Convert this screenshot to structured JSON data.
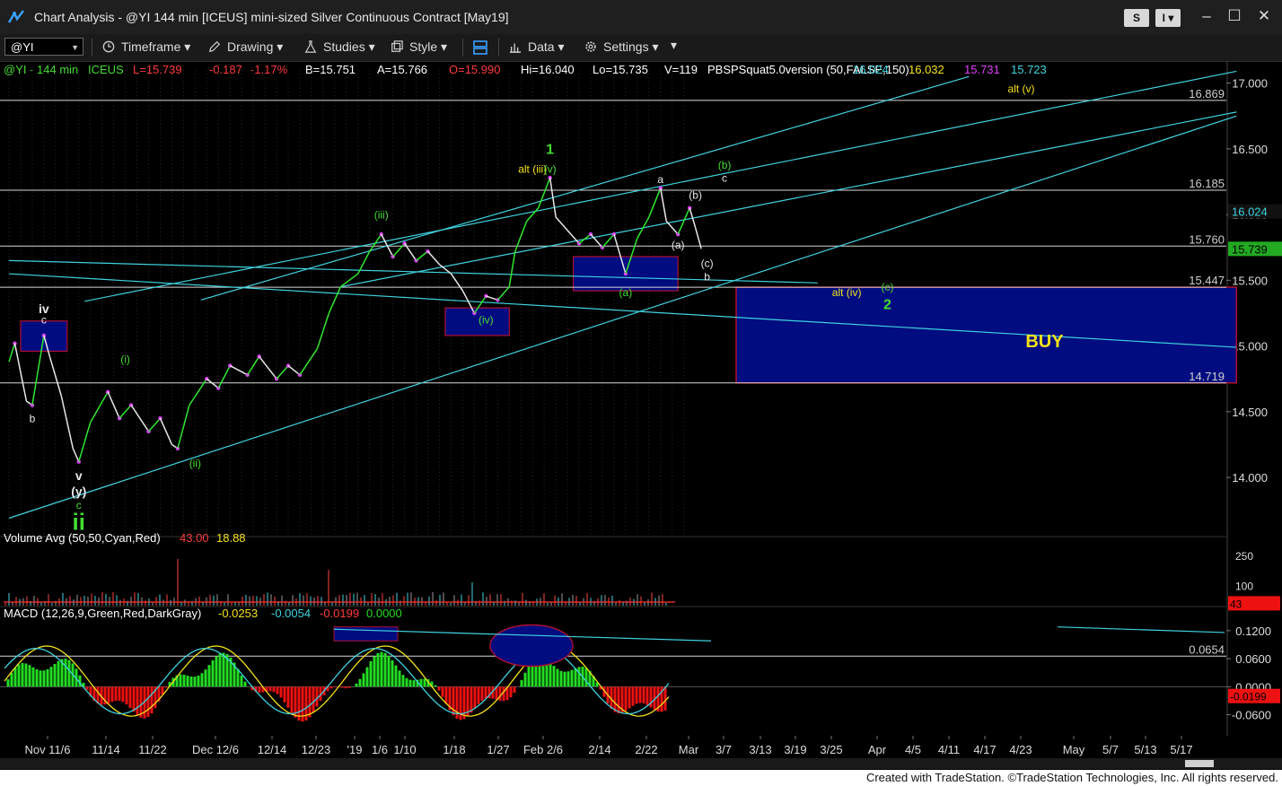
{
  "window": {
    "title": "Chart Analysis - @YI 144 min [ICEUS] mini-sized Silver Continuous Contract [May19]",
    "buttons": [
      "S",
      "I"
    ]
  },
  "toolbar": {
    "symbol": "@YI",
    "items": [
      "Timeframe",
      "Drawing",
      "Studies",
      "Style",
      "Data",
      "Settings"
    ]
  },
  "legend": {
    "symbol": "@YI - 144 min",
    "exchange": "ICEUS",
    "last": "L=15.739",
    "change": "-0.187",
    "pct": "-1.17%",
    "bid": "B=15.751",
    "ask": "A=15.766",
    "open": "O=15.990",
    "hi": "Hi=16.040",
    "lo": "Lo=15.735",
    "vol": "V=119",
    "indicator": "PBSPSquat5.0version (50,FALSE,150)",
    "ind_values": [
      "16.024",
      "16.032",
      "15.731",
      "15.723"
    ]
  },
  "colors": {
    "background": "#000000",
    "grid": "#3a3a3a",
    "cyan": "#3fd3e0",
    "up_bar": "#2ee82e",
    "down_bar": "#e8e8e8",
    "macd_pos": "#22dd22",
    "macd_neg": "#ee1111",
    "buy_box": "#000c80",
    "yellow": "#f5e21a",
    "green": "#44dd33",
    "magenta": "#e040fb"
  },
  "chart_data": [
    {
      "type": "line",
      "title": "@YI - 144 min",
      "y_axis_ticks": [
        "17.000",
        "16.500",
        "16.000",
        "15.500",
        "15.000",
        "14.500",
        "14.000"
      ],
      "ylim": [
        13.55,
        17.1
      ],
      "x_axis_labels": [
        "Nov 11/6",
        "11/14",
        "11/22",
        "Dec 12/6",
        "12/14",
        "12/23",
        "'19",
        "1/6",
        "1/10",
        "1/18",
        "1/27",
        "Feb 2/6",
        "2/14",
        "2/22",
        "Mar",
        "3/7",
        "3/13",
        "3/19",
        "3/25",
        "Apr",
        "4/5",
        "4/11",
        "4/17",
        "4/23",
        "May",
        "5/7",
        "5/13",
        "5/17"
      ],
      "price_path": [
        {
          "x": "Nov 1",
          "y": 14.88
        },
        {
          "x": "Nov 2",
          "y": 15.02
        },
        {
          "x": "Nov 4",
          "y": 14.58
        },
        {
          "x": "Nov 5",
          "y": 14.55
        },
        {
          "x": "Nov 7",
          "y": 15.08
        },
        {
          "x": "Nov 8",
          "y": 14.92
        },
        {
          "x": "Nov 10",
          "y": 14.62
        },
        {
          "x": "Nov 12",
          "y": 14.22
        },
        {
          "x": "Nov 13",
          "y": 14.12
        },
        {
          "x": "Nov 15",
          "y": 14.42
        },
        {
          "x": "Nov 18",
          "y": 14.65
        },
        {
          "x": "Nov 20",
          "y": 14.45
        },
        {
          "x": "Nov 22",
          "y": 14.55
        },
        {
          "x": "Nov 25",
          "y": 14.35
        },
        {
          "x": "Nov 27",
          "y": 14.45
        },
        {
          "x": "Nov 29",
          "y": 14.25
        },
        {
          "x": "Nov 30",
          "y": 14.22
        },
        {
          "x": "Dec 2",
          "y": 14.55
        },
        {
          "x": "Dec 5",
          "y": 14.75
        },
        {
          "x": "Dec 7",
          "y": 14.68
        },
        {
          "x": "Dec 9",
          "y": 14.85
        },
        {
          "x": "Dec 12",
          "y": 14.78
        },
        {
          "x": "Dec 14",
          "y": 14.92
        },
        {
          "x": "Dec 17",
          "y": 14.75
        },
        {
          "x": "Dec 19",
          "y": 14.85
        },
        {
          "x": "Dec 21",
          "y": 14.78
        },
        {
          "x": "Dec 24",
          "y": 14.98
        },
        {
          "x": "Dec 26",
          "y": 15.25
        },
        {
          "x": "Dec 28",
          "y": 15.45
        },
        {
          "x": "Dec 31",
          "y": 15.55
        },
        {
          "x": "Jan 2",
          "y": 15.72
        },
        {
          "x": "Jan 4",
          "y": 15.85
        },
        {
          "x": "Jan 6",
          "y": 15.68
        },
        {
          "x": "Jan 8",
          "y": 15.78
        },
        {
          "x": "Jan 10",
          "y": 15.65
        },
        {
          "x": "Jan 12",
          "y": 15.72
        },
        {
          "x": "Jan 14",
          "y": 15.62
        },
        {
          "x": "Jan 16",
          "y": 15.55
        },
        {
          "x": "Jan 18",
          "y": 15.42
        },
        {
          "x": "Jan 20",
          "y": 15.25
        },
        {
          "x": "Jan 22",
          "y": 15.38
        },
        {
          "x": "Jan 24",
          "y": 15.35
        },
        {
          "x": "Jan 26",
          "y": 15.45
        },
        {
          "x": "Jan 27",
          "y": 15.72
        },
        {
          "x": "Jan 29",
          "y": 15.95
        },
        {
          "x": "Jan 31",
          "y": 16.05
        },
        {
          "x": "Feb 2",
          "y": 16.28
        },
        {
          "x": "Feb 3",
          "y": 15.98
        },
        {
          "x": "Feb 5",
          "y": 15.88
        },
        {
          "x": "Feb 7",
          "y": 15.78
        },
        {
          "x": "Feb 9",
          "y": 15.85
        },
        {
          "x": "Feb 11",
          "y": 15.75
        },
        {
          "x": "Feb 13",
          "y": 15.85
        },
        {
          "x": "Feb 15",
          "y": 15.55
        },
        {
          "x": "Feb 17",
          "y": 15.82
        },
        {
          "x": "Feb 19",
          "y": 15.98
        },
        {
          "x": "Feb 21",
          "y": 16.2
        },
        {
          "x": "Feb 22",
          "y": 15.95
        },
        {
          "x": "Feb 24",
          "y": 15.85
        },
        {
          "x": "Feb 26",
          "y": 16.05
        },
        {
          "x": "Feb 27",
          "y": 15.9
        },
        {
          "x": "Feb 28",
          "y": 15.74
        }
      ],
      "horizontal_levels": [
        "16.869",
        "16.185",
        "15.760",
        "15.447",
        "14.719"
      ],
      "last_price": "15.739",
      "indicator_value": "16.024",
      "wave_labels": [
        {
          "text": "iv",
          "x": "Nov 7",
          "y": 15.25,
          "color": "white"
        },
        {
          "text": "c",
          "x": "Nov 7",
          "y": 15.17,
          "color": "white"
        },
        {
          "text": "b",
          "x": "Nov 5",
          "y": 14.42,
          "color": "white"
        },
        {
          "text": "(i)",
          "x": "Nov 21",
          "y": 14.87,
          "color": "green"
        },
        {
          "text": "(ii)",
          "x": "Dec 3",
          "y": 14.08,
          "color": "green"
        },
        {
          "text": "v",
          "x": "Nov 13",
          "y": 13.98,
          "color": "white"
        },
        {
          "text": "(y)",
          "x": "Nov 13",
          "y": 13.86,
          "color": "white"
        },
        {
          "text": "c",
          "x": "Nov 13",
          "y": 13.76,
          "color": "green"
        },
        {
          "text": "ii",
          "x": "Nov 13",
          "y": 13.6,
          "color": "green"
        },
        {
          "text": "(iii)",
          "x": "Jan 4",
          "y": 15.97,
          "color": "green"
        },
        {
          "text": "(iv)",
          "x": "Jan 22",
          "y": 15.17,
          "color": "green"
        },
        {
          "text": "alt (iii)",
          "x": "Jan 30",
          "y": 16.32,
          "color": "yellow"
        },
        {
          "text": "1",
          "x": "Feb 2",
          "y": 16.46,
          "color": "green"
        },
        {
          "text": "(v)",
          "x": "Feb 2",
          "y": 16.32,
          "color": "green"
        },
        {
          "text": "a",
          "x": "Feb 21",
          "y": 16.24,
          "color": "white"
        },
        {
          "text": "(b)",
          "x": "Feb 27",
          "y": 16.12,
          "color": "white"
        },
        {
          "text": "(a)",
          "x": "Feb 24",
          "y": 15.74,
          "color": "white"
        },
        {
          "text": "(a)",
          "x": "Feb 15",
          "y": 15.38,
          "color": "green"
        },
        {
          "text": "(c)",
          "x": "Mar 1",
          "y": 15.6,
          "color": "white"
        },
        {
          "text": "b",
          "x": "Mar 1",
          "y": 15.5,
          "color": "white"
        },
        {
          "text": "(b)",
          "x": "Mar 4",
          "y": 16.35,
          "color": "green"
        },
        {
          "text": "c",
          "x": "Mar 4",
          "y": 16.25,
          "color": "white"
        },
        {
          "text": "alt (iv)",
          "x": "Mar 25",
          "y": 15.38,
          "color": "yellow"
        },
        {
          "text": "(c)",
          "x": "Apr 1",
          "y": 15.42,
          "color": "green"
        },
        {
          "text": "2",
          "x": "Apr 1",
          "y": 15.28,
          "color": "green"
        },
        {
          "text": "alt (v)",
          "x": "Apr 24",
          "y": 16.93,
          "color": "yellow"
        },
        {
          "text": "BUY",
          "x": "Apr 28",
          "y": 14.99,
          "color": "yellow"
        }
      ],
      "buy_zone": {
        "x0": "Mar 6",
        "x1": "May 31",
        "y_top": 15.447,
        "y_bottom": 14.719
      },
      "boxes": [
        {
          "x0": "Nov 3",
          "x1": "Nov 11",
          "y_top": 15.19,
          "y_bottom": 14.96
        },
        {
          "x0": "Jan 15",
          "x1": "Jan 26",
          "y_top": 15.29,
          "y_bottom": 15.08
        },
        {
          "x0": "Feb 6",
          "x1": "Feb 24",
          "y_top": 15.68,
          "y_bottom": 15.42
        }
      ]
    },
    {
      "type": "bar",
      "title": "Volume Avg (50,50,Cyan,Red)",
      "values_shown": [
        "43.00",
        "18.88"
      ],
      "y_axis_ticks": [
        "250",
        "100"
      ],
      "current_value": "43"
    },
    {
      "type": "area",
      "title": "MACD (12,26,9,Green,Red,DarkGray)",
      "values_shown": [
        "-0.0253",
        "-0.0054",
        "-0.0199",
        "0.0000"
      ],
      "y_axis_ticks": [
        "0.1200",
        "0.0600",
        "0.0000",
        "-0.0600"
      ],
      "ylim": [
        -0.105,
        0.16
      ],
      "level": "0.0654",
      "current_value": "-0.0199"
    }
  ],
  "footer": {
    "text": "Created with TradeStation. ©TradeStation Technologies, Inc. All rights reserved."
  }
}
